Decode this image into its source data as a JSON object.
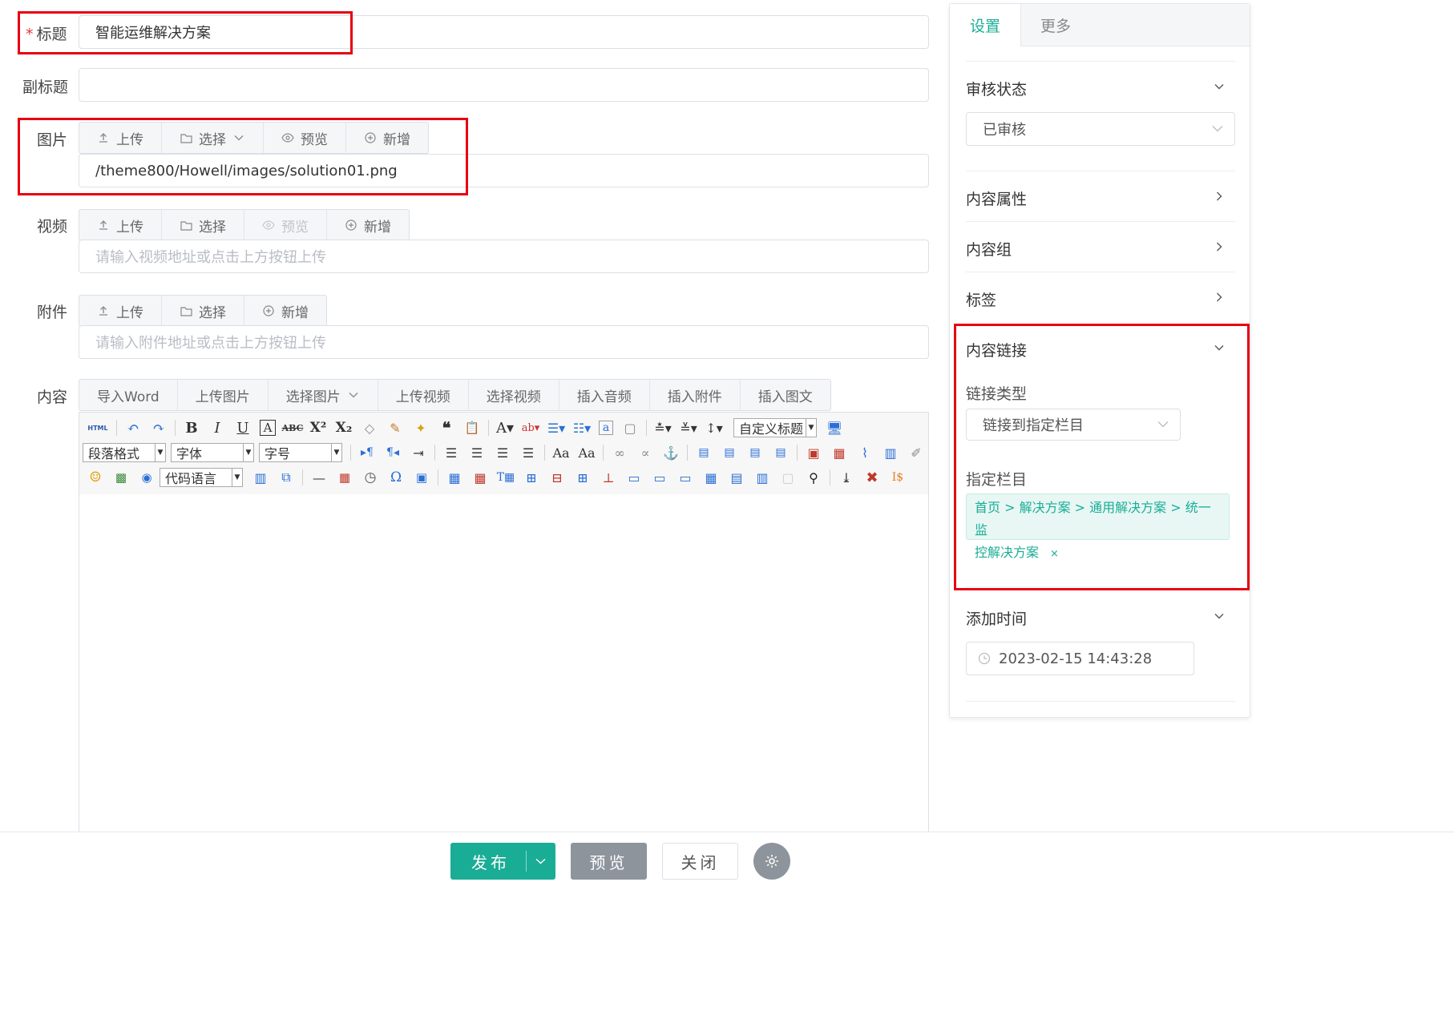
{
  "form": {
    "title_label": "标题",
    "title_value": "智能运维解决方案",
    "subtitle_label": "副标题",
    "subtitle_value": "",
    "image_label": "图片",
    "image_value": "/theme800/Howell/images/solution01.png",
    "video_label": "视频",
    "video_placeholder": "请输入视频地址或点击上方按钮上传",
    "attachment_label": "附件",
    "attachment_placeholder": "请输入附件地址或点击上方按钮上传",
    "content_label": "内容"
  },
  "buttons": {
    "upload": "上传",
    "select": "选择",
    "preview": "预览",
    "add": "新增"
  },
  "content_tabs": [
    "导入Word",
    "上传图片",
    "选择图片",
    "上传视频",
    "选择视频",
    "插入音频",
    "插入附件",
    "插入图文"
  ],
  "editor": {
    "html_label": "HTML",
    "paragraph_select": "段落格式",
    "font_select": "字体",
    "size_select": "字号",
    "custom_title_select": "自定义标题",
    "code_lang_select": "代码语言"
  },
  "sidebar": {
    "tab_settings": "设置",
    "tab_more": "更多",
    "review_status_title": "审核状态",
    "review_status_value": "已审核",
    "content_attr": "内容属性",
    "content_group": "内容组",
    "tags": "标签",
    "content_link": "内容链接",
    "link_type_label": "链接类型",
    "link_type_value": "链接到指定栏目",
    "target_column_label": "指定栏目",
    "target_column_path_line1": "首页 > 解决方案 > 通用解决方案 > 统一监",
    "target_column_path_line2": "控解决方案",
    "target_column_remove": "×",
    "add_time_title": "添加时间",
    "add_time_value": "2023-02-15 14:43:28"
  },
  "footer": {
    "publish": "发布",
    "preview": "预览",
    "close": "关闭"
  },
  "colors": {
    "accent": "#1aad96",
    "highlight": "#e60012",
    "preview_btn": "#8e949c"
  }
}
